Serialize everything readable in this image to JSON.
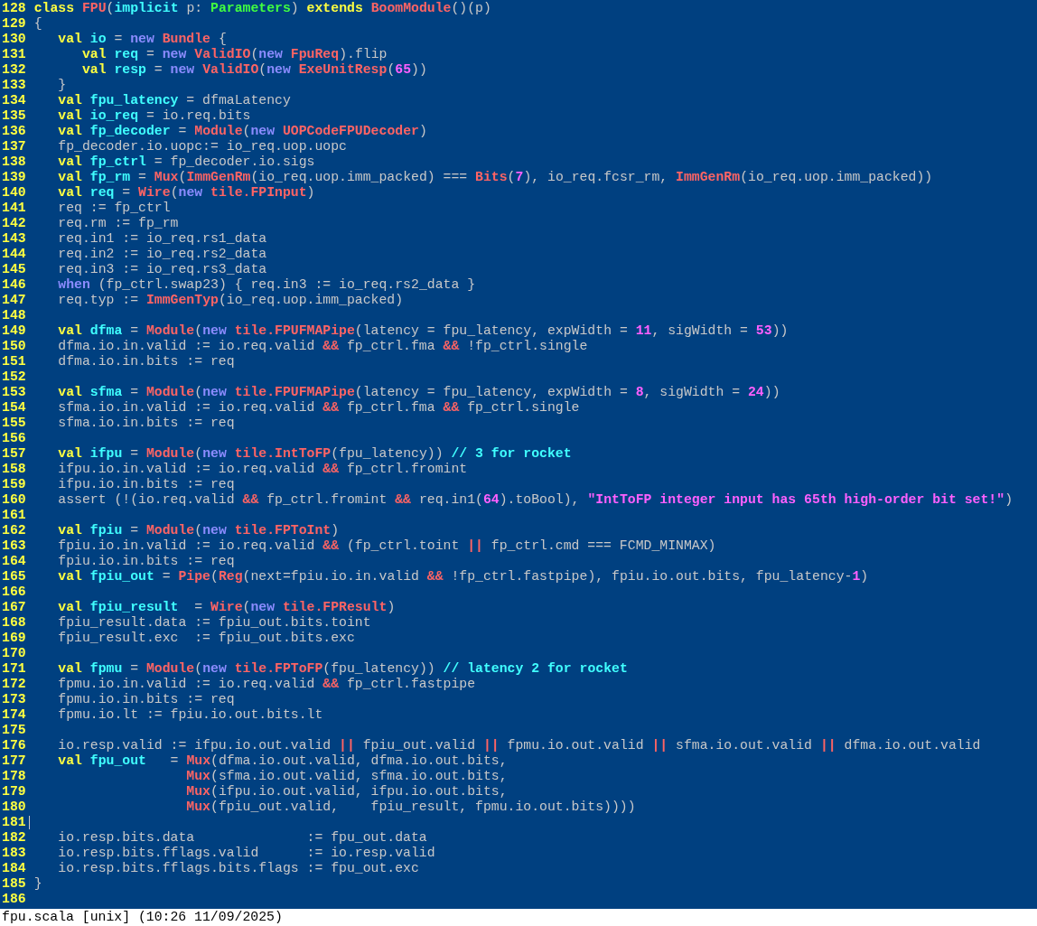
{
  "editor": {
    "lines": [
      {
        "number": "128",
        "cursor": false,
        "segments": [
          {
            "kind": "keyword",
            "text": "class"
          },
          {
            "kind": "type",
            "text": " FPU"
          },
          {
            "kind": "plain",
            "text": "("
          },
          {
            "kind": "ident",
            "text": "implicit"
          },
          {
            "kind": "plain",
            "text": " p: "
          },
          {
            "kind": "param",
            "text": "Parameters"
          },
          {
            "kind": "plain",
            "text": ") "
          },
          {
            "kind": "keyword",
            "text": "extends"
          },
          {
            "kind": "type",
            "text": " BoomModule"
          },
          {
            "kind": "plain",
            "text": "()(p)"
          }
        ]
      },
      {
        "number": "129",
        "cursor": false,
        "segments": [
          {
            "kind": "plain",
            "text": "{"
          }
        ]
      },
      {
        "number": "130",
        "cursor": false,
        "segments": [
          {
            "kind": "keyword",
            "text": "   val"
          },
          {
            "kind": "ident",
            "text": " io"
          },
          {
            "kind": "plain",
            "text": " = "
          },
          {
            "kind": "new",
            "text": "new"
          },
          {
            "kind": "type",
            "text": " Bundle"
          },
          {
            "kind": "plain",
            "text": " {"
          }
        ]
      },
      {
        "number": "131",
        "cursor": false,
        "segments": [
          {
            "kind": "keyword",
            "text": "      val"
          },
          {
            "kind": "ident",
            "text": " req"
          },
          {
            "kind": "plain",
            "text": " = "
          },
          {
            "kind": "new",
            "text": "new"
          },
          {
            "kind": "type",
            "text": " ValidIO"
          },
          {
            "kind": "plain",
            "text": "("
          },
          {
            "kind": "new",
            "text": "new"
          },
          {
            "kind": "type",
            "text": " FpuReq"
          },
          {
            "kind": "plain",
            "text": ").flip"
          }
        ]
      },
      {
        "number": "132",
        "cursor": false,
        "segments": [
          {
            "kind": "keyword",
            "text": "      val"
          },
          {
            "kind": "ident",
            "text": " resp"
          },
          {
            "kind": "plain",
            "text": " = "
          },
          {
            "kind": "new",
            "text": "new"
          },
          {
            "kind": "type",
            "text": " ValidIO"
          },
          {
            "kind": "plain",
            "text": "("
          },
          {
            "kind": "new",
            "text": "new"
          },
          {
            "kind": "type",
            "text": " ExeUnitResp"
          },
          {
            "kind": "plain",
            "text": "("
          },
          {
            "kind": "number",
            "text": "65"
          },
          {
            "kind": "plain",
            "text": "))"
          }
        ]
      },
      {
        "number": "133",
        "cursor": false,
        "segments": [
          {
            "kind": "plain",
            "text": "   }"
          }
        ]
      },
      {
        "number": "134",
        "cursor": false,
        "segments": [
          {
            "kind": "keyword",
            "text": "   val"
          },
          {
            "kind": "ident",
            "text": " fpu_latency"
          },
          {
            "kind": "plain",
            "text": " = dfmaLatency"
          }
        ]
      },
      {
        "number": "135",
        "cursor": false,
        "segments": [
          {
            "kind": "keyword",
            "text": "   val"
          },
          {
            "kind": "ident",
            "text": " io_req"
          },
          {
            "kind": "plain",
            "text": " = io.req.bits"
          }
        ]
      },
      {
        "number": "136",
        "cursor": false,
        "segments": [
          {
            "kind": "keyword",
            "text": "   val"
          },
          {
            "kind": "ident",
            "text": " fp_decoder"
          },
          {
            "kind": "plain",
            "text": " = "
          },
          {
            "kind": "type",
            "text": "Module"
          },
          {
            "kind": "plain",
            "text": "("
          },
          {
            "kind": "new",
            "text": "new"
          },
          {
            "kind": "type",
            "text": " UOPCodeFPUDecoder"
          },
          {
            "kind": "plain",
            "text": ")"
          }
        ]
      },
      {
        "number": "137",
        "cursor": false,
        "segments": [
          {
            "kind": "plain",
            "text": "   fp_decoder.io.uopc:= io_req.uop.uopc"
          }
        ]
      },
      {
        "number": "138",
        "cursor": false,
        "segments": [
          {
            "kind": "keyword",
            "text": "   val"
          },
          {
            "kind": "ident",
            "text": " fp_ctrl"
          },
          {
            "kind": "plain",
            "text": " = fp_decoder.io.sigs"
          }
        ]
      },
      {
        "number": "139",
        "cursor": false,
        "segments": [
          {
            "kind": "keyword",
            "text": "   val"
          },
          {
            "kind": "ident",
            "text": " fp_rm"
          },
          {
            "kind": "plain",
            "text": " = "
          },
          {
            "kind": "type",
            "text": "Mux"
          },
          {
            "kind": "plain",
            "text": "("
          },
          {
            "kind": "type",
            "text": "ImmGenRm"
          },
          {
            "kind": "plain",
            "text": "(io_req.uop.imm_packed) === "
          },
          {
            "kind": "type",
            "text": "Bits"
          },
          {
            "kind": "plain",
            "text": "("
          },
          {
            "kind": "number",
            "text": "7"
          },
          {
            "kind": "plain",
            "text": "), io_req.fcsr_rm, "
          },
          {
            "kind": "type",
            "text": "ImmGenRm"
          },
          {
            "kind": "plain",
            "text": "(io_req.uop.imm_packed))"
          }
        ]
      },
      {
        "number": "140",
        "cursor": false,
        "segments": [
          {
            "kind": "keyword",
            "text": "   val"
          },
          {
            "kind": "ident",
            "text": " req"
          },
          {
            "kind": "plain",
            "text": " = "
          },
          {
            "kind": "type",
            "text": "Wire"
          },
          {
            "kind": "plain",
            "text": "("
          },
          {
            "kind": "new",
            "text": "new"
          },
          {
            "kind": "type",
            "text": " tile.FPInput"
          },
          {
            "kind": "plain",
            "text": ")"
          }
        ]
      },
      {
        "number": "141",
        "cursor": false,
        "segments": [
          {
            "kind": "plain",
            "text": "   req := fp_ctrl"
          }
        ]
      },
      {
        "number": "142",
        "cursor": false,
        "segments": [
          {
            "kind": "plain",
            "text": "   req.rm := fp_rm"
          }
        ]
      },
      {
        "number": "143",
        "cursor": false,
        "segments": [
          {
            "kind": "plain",
            "text": "   req.in1 := io_req.rs1_data"
          }
        ]
      },
      {
        "number": "144",
        "cursor": false,
        "segments": [
          {
            "kind": "plain",
            "text": "   req.in2 := io_req.rs2_data"
          }
        ]
      },
      {
        "number": "145",
        "cursor": false,
        "segments": [
          {
            "kind": "plain",
            "text": "   req.in3 := io_req.rs3_data"
          }
        ]
      },
      {
        "number": "146",
        "cursor": false,
        "segments": [
          {
            "kind": "new",
            "text": "   when"
          },
          {
            "kind": "plain",
            "text": " (fp_ctrl.swap23) { req.in3 := io_req.rs2_data }"
          }
        ]
      },
      {
        "number": "147",
        "cursor": false,
        "segments": [
          {
            "kind": "plain",
            "text": "   req.typ := "
          },
          {
            "kind": "type",
            "text": "ImmGenTyp"
          },
          {
            "kind": "plain",
            "text": "(io_req.uop.imm_packed)"
          }
        ]
      },
      {
        "number": "148",
        "cursor": false
      },
      {
        "number": "149",
        "cursor": false,
        "segments": [
          {
            "kind": "keyword",
            "text": "   val"
          },
          {
            "kind": "ident",
            "text": " dfma"
          },
          {
            "kind": "plain",
            "text": " = "
          },
          {
            "kind": "type",
            "text": "Module"
          },
          {
            "kind": "plain",
            "text": "("
          },
          {
            "kind": "new",
            "text": "new"
          },
          {
            "kind": "type",
            "text": " tile.FPUFMAPipe"
          },
          {
            "kind": "plain",
            "text": "(latency = fpu_latency, expWidth = "
          },
          {
            "kind": "number",
            "text": "11"
          },
          {
            "kind": "plain",
            "text": ", sigWidth = "
          },
          {
            "kind": "number",
            "text": "53"
          },
          {
            "kind": "plain",
            "text": "))"
          }
        ]
      },
      {
        "number": "150",
        "cursor": false,
        "segments": [
          {
            "kind": "plain",
            "text": "   dfma.io.in.valid := io.req.valid "
          },
          {
            "kind": "operator",
            "text": "&&"
          },
          {
            "kind": "plain",
            "text": " fp_ctrl.fma "
          },
          {
            "kind": "operator",
            "text": "&&"
          },
          {
            "kind": "plain",
            "text": " !fp_ctrl.single"
          }
        ]
      },
      {
        "number": "151",
        "cursor": false,
        "segments": [
          {
            "kind": "plain",
            "text": "   dfma.io.in.bits := req"
          }
        ]
      },
      {
        "number": "152",
        "cursor": false
      },
      {
        "number": "153",
        "cursor": false,
        "segments": [
          {
            "kind": "keyword",
            "text": "   val"
          },
          {
            "kind": "ident",
            "text": " sfma"
          },
          {
            "kind": "plain",
            "text": " = "
          },
          {
            "kind": "type",
            "text": "Module"
          },
          {
            "kind": "plain",
            "text": "("
          },
          {
            "kind": "new",
            "text": "new"
          },
          {
            "kind": "type",
            "text": " tile.FPUFMAPipe"
          },
          {
            "kind": "plain",
            "text": "(latency = fpu_latency, expWidth = "
          },
          {
            "kind": "number",
            "text": "8"
          },
          {
            "kind": "plain",
            "text": ", sigWidth = "
          },
          {
            "kind": "number",
            "text": "24"
          },
          {
            "kind": "plain",
            "text": "))"
          }
        ]
      },
      {
        "number": "154",
        "cursor": false,
        "segments": [
          {
            "kind": "plain",
            "text": "   sfma.io.in.valid := io.req.valid "
          },
          {
            "kind": "operator",
            "text": "&&"
          },
          {
            "kind": "plain",
            "text": " fp_ctrl.fma "
          },
          {
            "kind": "operator",
            "text": "&&"
          },
          {
            "kind": "plain",
            "text": " fp_ctrl.single"
          }
        ]
      },
      {
        "number": "155",
        "cursor": false,
        "segments": [
          {
            "kind": "plain",
            "text": "   sfma.io.in.bits := req"
          }
        ]
      },
      {
        "number": "156",
        "cursor": false
      },
      {
        "number": "157",
        "cursor": false,
        "segments": [
          {
            "kind": "keyword",
            "text": "   val"
          },
          {
            "kind": "ident",
            "text": " ifpu"
          },
          {
            "kind": "plain",
            "text": " = "
          },
          {
            "kind": "type",
            "text": "Module"
          },
          {
            "kind": "plain",
            "text": "("
          },
          {
            "kind": "new",
            "text": "new"
          },
          {
            "kind": "type",
            "text": " tile.IntToFP"
          },
          {
            "kind": "plain",
            "text": "(fpu_latency)) "
          },
          {
            "kind": "comment",
            "text": "// 3 for rocket"
          }
        ]
      },
      {
        "number": "158",
        "cursor": false,
        "segments": [
          {
            "kind": "plain",
            "text": "   ifpu.io.in.valid := io.req.valid "
          },
          {
            "kind": "operator",
            "text": "&&"
          },
          {
            "kind": "plain",
            "text": " fp_ctrl.fromint"
          }
        ]
      },
      {
        "number": "159",
        "cursor": false,
        "segments": [
          {
            "kind": "plain",
            "text": "   ifpu.io.in.bits := req"
          }
        ]
      },
      {
        "number": "160",
        "cursor": false,
        "segments": [
          {
            "kind": "plain",
            "text": "   assert (!(io.req.valid "
          },
          {
            "kind": "operator",
            "text": "&&"
          },
          {
            "kind": "plain",
            "text": " fp_ctrl.fromint "
          },
          {
            "kind": "operator",
            "text": "&&"
          },
          {
            "kind": "plain",
            "text": " req.in1("
          },
          {
            "kind": "number",
            "text": "64"
          },
          {
            "kind": "plain",
            "text": ").toBool), "
          },
          {
            "kind": "string",
            "text": "\"IntToFP integer input has 65th high-order bit set!\""
          },
          {
            "kind": "plain",
            "text": ")"
          }
        ]
      },
      {
        "number": "161",
        "cursor": false
      },
      {
        "number": "162",
        "cursor": false,
        "segments": [
          {
            "kind": "keyword",
            "text": "   val"
          },
          {
            "kind": "ident",
            "text": " fpiu"
          },
          {
            "kind": "plain",
            "text": " = "
          },
          {
            "kind": "type",
            "text": "Module"
          },
          {
            "kind": "plain",
            "text": "("
          },
          {
            "kind": "new",
            "text": "new"
          },
          {
            "kind": "type",
            "text": " tile.FPToInt"
          },
          {
            "kind": "plain",
            "text": ")"
          }
        ]
      },
      {
        "number": "163",
        "cursor": false,
        "segments": [
          {
            "kind": "plain",
            "text": "   fpiu.io.in.valid := io.req.valid "
          },
          {
            "kind": "operator",
            "text": "&&"
          },
          {
            "kind": "plain",
            "text": " (fp_ctrl.toint "
          },
          {
            "kind": "operator",
            "text": "||"
          },
          {
            "kind": "plain",
            "text": " fp_ctrl.cmd === FCMD_MINMAX)"
          }
        ]
      },
      {
        "number": "164",
        "cursor": false,
        "segments": [
          {
            "kind": "plain",
            "text": "   fpiu.io.in.bits := req"
          }
        ]
      },
      {
        "number": "165",
        "cursor": false,
        "segments": [
          {
            "kind": "keyword",
            "text": "   val"
          },
          {
            "kind": "ident",
            "text": " fpiu_out"
          },
          {
            "kind": "plain",
            "text": " = "
          },
          {
            "kind": "type",
            "text": "Pipe"
          },
          {
            "kind": "plain",
            "text": "("
          },
          {
            "kind": "type",
            "text": "Reg"
          },
          {
            "kind": "plain",
            "text": "(next=fpiu.io.in.valid "
          },
          {
            "kind": "operator",
            "text": "&&"
          },
          {
            "kind": "plain",
            "text": " !fp_ctrl.fastpipe), fpiu.io.out.bits, fpu_latency-"
          },
          {
            "kind": "number",
            "text": "1"
          },
          {
            "kind": "plain",
            "text": ")"
          }
        ]
      },
      {
        "number": "166",
        "cursor": false
      },
      {
        "number": "167",
        "cursor": false,
        "segments": [
          {
            "kind": "keyword",
            "text": "   val"
          },
          {
            "kind": "ident",
            "text": " fpiu_result"
          },
          {
            "kind": "plain",
            "text": "  = "
          },
          {
            "kind": "type",
            "text": "Wire"
          },
          {
            "kind": "plain",
            "text": "("
          },
          {
            "kind": "new",
            "text": "new"
          },
          {
            "kind": "type",
            "text": " tile.FPResult"
          },
          {
            "kind": "plain",
            "text": ")"
          }
        ]
      },
      {
        "number": "168",
        "cursor": false,
        "segments": [
          {
            "kind": "plain",
            "text": "   fpiu_result.data := fpiu_out.bits.toint"
          }
        ]
      },
      {
        "number": "169",
        "cursor": false,
        "segments": [
          {
            "kind": "plain",
            "text": "   fpiu_result.exc  := fpiu_out.bits.exc"
          }
        ]
      },
      {
        "number": "170",
        "cursor": false
      },
      {
        "number": "171",
        "cursor": false,
        "segments": [
          {
            "kind": "keyword",
            "text": "   val"
          },
          {
            "kind": "ident",
            "text": " fpmu"
          },
          {
            "kind": "plain",
            "text": " = "
          },
          {
            "kind": "type",
            "text": "Module"
          },
          {
            "kind": "plain",
            "text": "("
          },
          {
            "kind": "new",
            "text": "new"
          },
          {
            "kind": "type",
            "text": " tile.FPToFP"
          },
          {
            "kind": "plain",
            "text": "(fpu_latency)) "
          },
          {
            "kind": "comment",
            "text": "// latency 2 for rocket"
          }
        ]
      },
      {
        "number": "172",
        "cursor": false,
        "segments": [
          {
            "kind": "plain",
            "text": "   fpmu.io.in.valid := io.req.valid "
          },
          {
            "kind": "operator",
            "text": "&&"
          },
          {
            "kind": "plain",
            "text": " fp_ctrl.fastpipe"
          }
        ]
      },
      {
        "number": "173",
        "cursor": false,
        "segments": [
          {
            "kind": "plain",
            "text": "   fpmu.io.in.bits := req"
          }
        ]
      },
      {
        "number": "174",
        "cursor": false,
        "segments": [
          {
            "kind": "plain",
            "text": "   fpmu.io.lt := fpiu.io.out.bits.lt"
          }
        ]
      },
      {
        "number": "175",
        "cursor": false
      },
      {
        "number": "176",
        "cursor": false,
        "segments": [
          {
            "kind": "plain",
            "text": "   io.resp.valid := ifpu.io.out.valid "
          },
          {
            "kind": "operator",
            "text": "||"
          },
          {
            "kind": "plain",
            "text": " fpiu_out.valid "
          },
          {
            "kind": "operator",
            "text": "||"
          },
          {
            "kind": "plain",
            "text": " fpmu.io.out.valid "
          },
          {
            "kind": "operator",
            "text": "||"
          },
          {
            "kind": "plain",
            "text": " sfma.io.out.valid "
          },
          {
            "kind": "operator",
            "text": "||"
          },
          {
            "kind": "plain",
            "text": " dfma.io.out.valid"
          }
        ]
      },
      {
        "number": "177",
        "cursor": false,
        "segments": [
          {
            "kind": "keyword",
            "text": "   val"
          },
          {
            "kind": "ident",
            "text": " fpu_out"
          },
          {
            "kind": "plain",
            "text": "   = "
          },
          {
            "kind": "type",
            "text": "Mux"
          },
          {
            "kind": "plain",
            "text": "(dfma.io.out.valid, dfma.io.out.bits,"
          }
        ]
      },
      {
        "number": "178",
        "cursor": false,
        "segments": [
          {
            "kind": "type",
            "text": "                   Mux"
          },
          {
            "kind": "plain",
            "text": "(sfma.io.out.valid, sfma.io.out.bits,"
          }
        ]
      },
      {
        "number": "179",
        "cursor": false,
        "segments": [
          {
            "kind": "type",
            "text": "                   Mux"
          },
          {
            "kind": "plain",
            "text": "(ifpu.io.out.valid, ifpu.io.out.bits,"
          }
        ]
      },
      {
        "number": "180",
        "cursor": false,
        "segments": [
          {
            "kind": "type",
            "text": "                   Mux"
          },
          {
            "kind": "plain",
            "text": "(fpiu_out.valid,    fpiu_result, fpmu.io.out.bits))))"
          }
        ]
      },
      {
        "number": "181",
        "cursor": true
      },
      {
        "number": "182",
        "cursor": false,
        "segments": [
          {
            "kind": "plain",
            "text": "   io.resp.bits.data              := fpu_out.data"
          }
        ]
      },
      {
        "number": "183",
        "cursor": false,
        "segments": [
          {
            "kind": "plain",
            "text": "   io.resp.bits.fflags.valid      := io.resp.valid"
          }
        ]
      },
      {
        "number": "184",
        "cursor": false,
        "segments": [
          {
            "kind": "plain",
            "text": "   io.resp.bits.fflags.bits.flags := fpu_out.exc"
          }
        ]
      },
      {
        "number": "185",
        "cursor": false,
        "segments": [
          {
            "kind": "plain",
            "text": "}"
          }
        ]
      },
      {
        "number": "186",
        "cursor": false
      }
    ]
  },
  "status_bar": {
    "text": "fpu.scala [unix] (10:26 11/09/2025)"
  }
}
